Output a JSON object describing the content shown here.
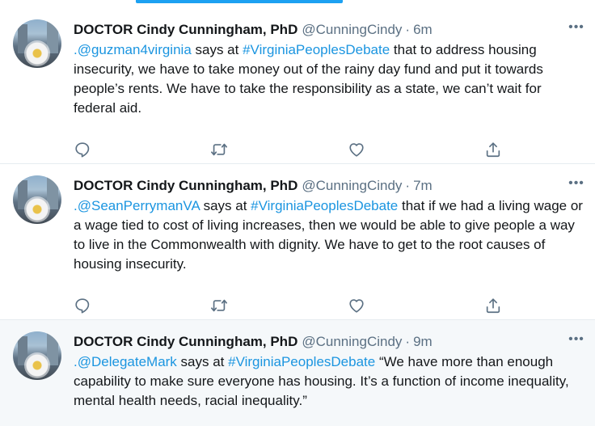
{
  "tweets": [
    {
      "name": "DOCTOR Cindy Cunningham, PhD",
      "handle": "@CunningCindy",
      "separator": "·",
      "time": "6m",
      "more": "•••",
      "mention": ".@guzman4virginia",
      "says": " says at ",
      "hashtag": "#VirginiaPeoplesDebate",
      "body": " that to address housing insecurity, we have to take money out of the rainy day fund and put it towards people’s rents. We have to take the responsibility as a state, we can’t wait for federal aid."
    },
    {
      "name": "DOCTOR Cindy Cunningham, PhD",
      "handle": "@CunningCindy",
      "separator": "·",
      "time": "7m",
      "more": "•••",
      "mention": ".@SeanPerrymanVA",
      "says": " says at ",
      "hashtag": "#VirginiaPeoplesDebate",
      "body": " that if we had a living wage or a wage tied to cost of living increases, then we would be able to give people a way to live in the Commonwealth with dignity. We have to get to the root causes of housing insecurity."
    },
    {
      "name": "DOCTOR Cindy Cunningham, PhD",
      "handle": "@CunningCindy",
      "separator": "·",
      "time": "9m",
      "more": "•••",
      "mention": ".@DelegateMark",
      "says": " says at ",
      "hashtag": "#VirginiaPeoplesDebate",
      "body": " “We have more than enough capability to make sure everyone has housing. It’s a function of income inequality, mental health needs, racial inequality.”"
    }
  ],
  "icons": {
    "reply": "reply-icon",
    "retweet": "retweet-icon",
    "like": "like-icon",
    "share": "share-icon",
    "more": "more-icon"
  },
  "colors": {
    "accent": "#1da1f2",
    "link": "#1b95e0",
    "secondary_text": "#5b7083",
    "primary_text": "#14171a",
    "divider": "#e6ecf0",
    "hover_background": "#f5f8fa"
  }
}
